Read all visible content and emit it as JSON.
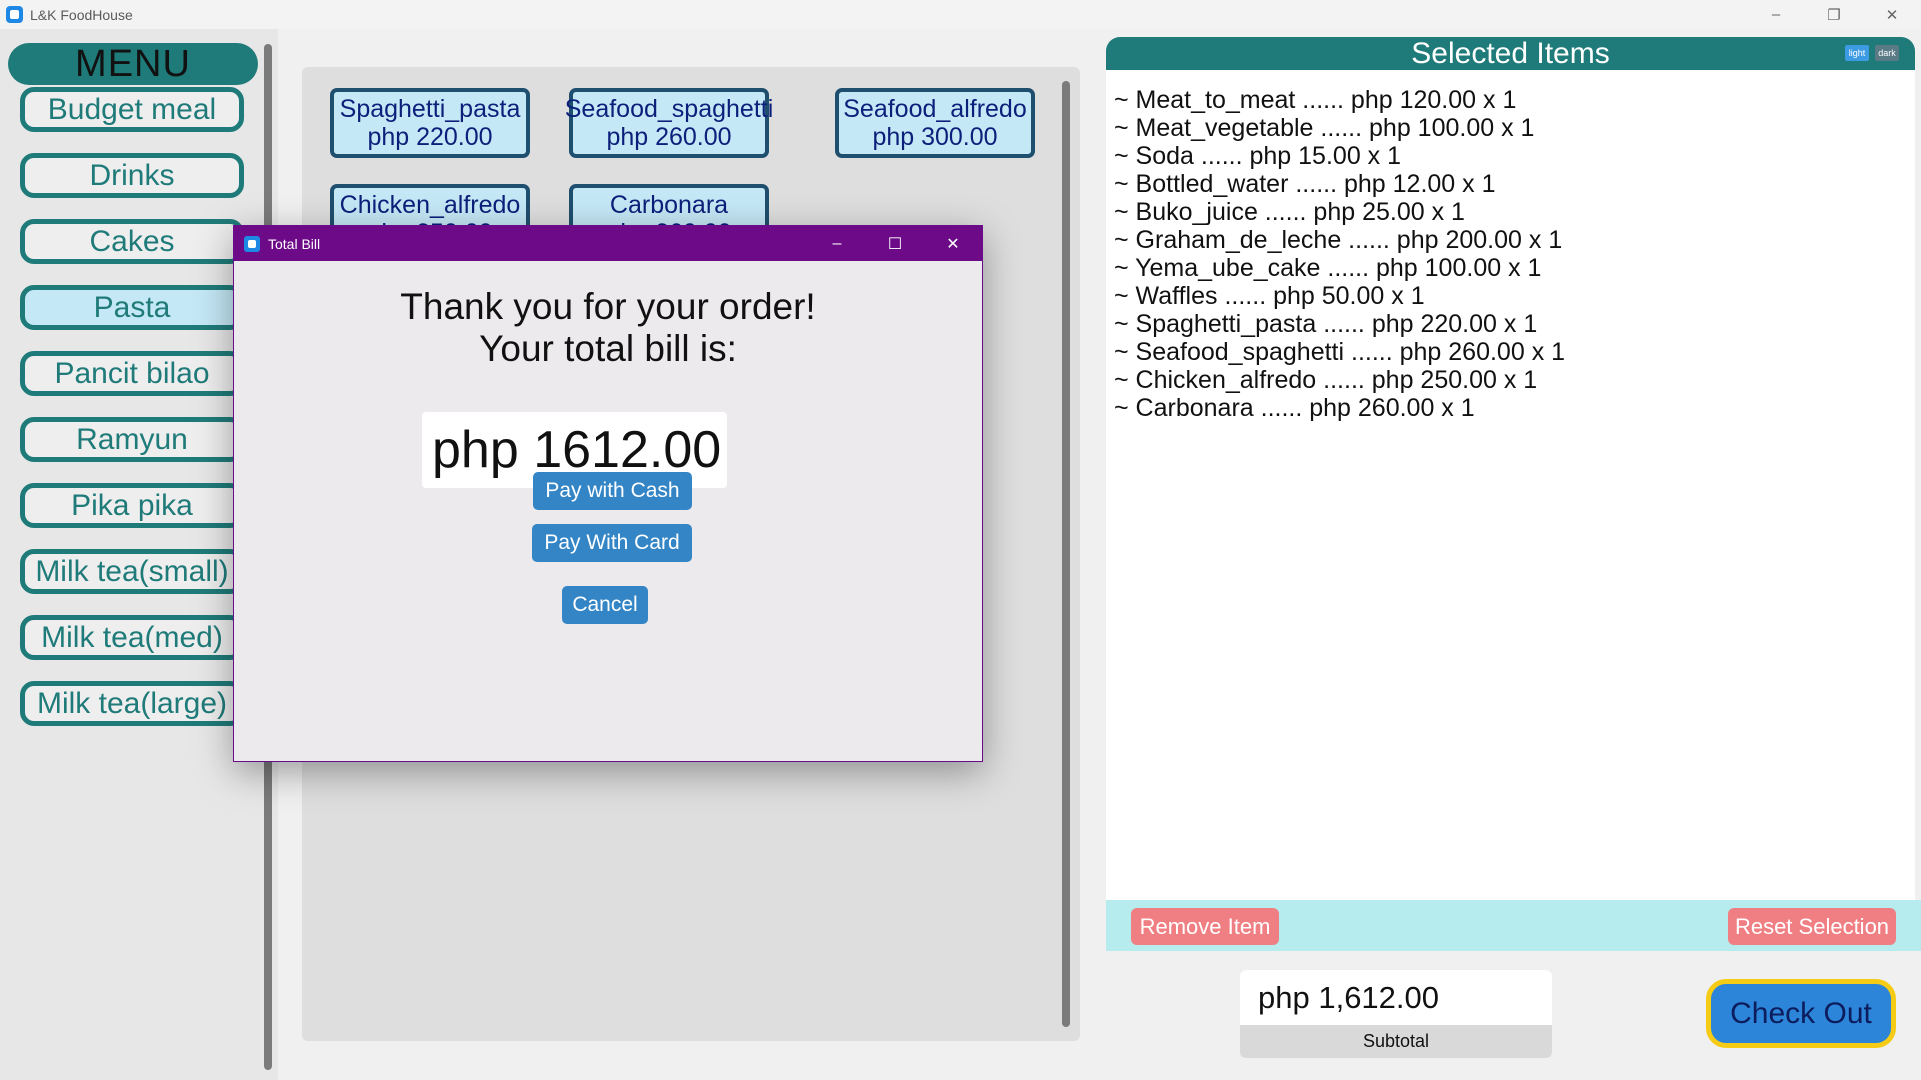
{
  "window": {
    "title": "L&K FoodHouse",
    "controls": [
      "–",
      "❐",
      "✕"
    ]
  },
  "menu": {
    "header": "MENU",
    "items": [
      {
        "label": "Budget meal"
      },
      {
        "label": "Drinks"
      },
      {
        "label": "Cakes"
      },
      {
        "label": "Pasta",
        "active": true
      },
      {
        "label": "Pancit bilao"
      },
      {
        "label": "Ramyun"
      },
      {
        "label": "Pika pika"
      },
      {
        "label": "Milk tea(small)"
      },
      {
        "label": "Milk tea(med)"
      },
      {
        "label": "Milk tea(large)"
      }
    ]
  },
  "food": {
    "items": [
      {
        "name": "Spaghetti_pasta",
        "price": "php 220.00"
      },
      {
        "name": "Seafood_spaghetti",
        "price": "php 260.00"
      },
      {
        "name": "Seafood_alfredo",
        "price": "php 300.00"
      },
      {
        "name": "Chicken_alfredo",
        "price": "php 250.00"
      },
      {
        "name": "Carbonara",
        "price": "php 260.00"
      }
    ]
  },
  "selected": {
    "title": "Selected Items",
    "theme_light": "light",
    "theme_dark": "dark",
    "items": [
      "~ Meat_to_meat ...... php 120.00 x 1",
      "~ Meat_vegetable ...... php 100.00 x 1",
      "~ Soda ...... php 15.00 x 1",
      "~ Bottled_water ...... php 12.00 x 1",
      "~ Buko_juice ...... php 25.00 x 1",
      "~ Graham_de_leche ...... php 200.00 x 1",
      "~ Yema_ube_cake ...... php 100.00 x 1",
      "~ Waffles ...... php 50.00 x 1",
      "~ Spaghetti_pasta ...... php 220.00 x 1",
      "~ Seafood_spaghetti ...... php 260.00 x 1",
      "~ Chicken_alfredo ...... php 250.00 x 1",
      "~ Carbonara ...... php 260.00 x 1"
    ],
    "remove_label": "Remove Item",
    "reset_label": "Reset Selection",
    "subtotal_value": "php 1,612.00",
    "subtotal_label": "Subtotal",
    "checkout_label": "Check Out"
  },
  "dialog": {
    "title": "Total Bill",
    "message_line1": "Thank you for your order!",
    "message_line2": "Your total bill is:",
    "total": "php 1612.00",
    "pay_cash": "Pay with Cash",
    "pay_card": "Pay With Card",
    "cancel": "Cancel",
    "controls": [
      "–",
      "☐",
      "✕"
    ]
  },
  "colors": {
    "teal": "#1f7b79",
    "dialog_titlebar": "#6c0a87",
    "checkout_border": "#f6cb15",
    "pink_button": "#f07f84",
    "blue_button": "#3385c6"
  }
}
